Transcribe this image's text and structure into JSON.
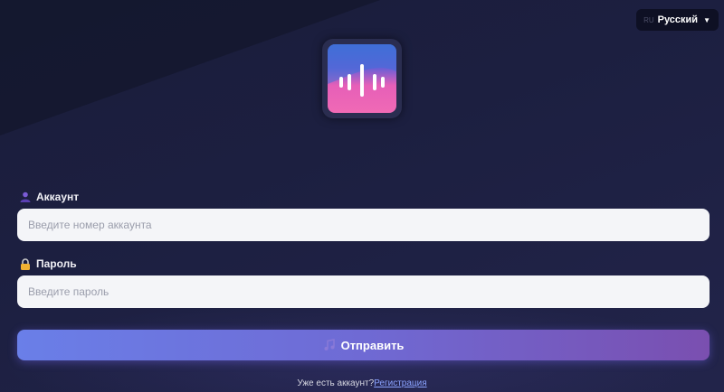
{
  "language": {
    "code": "RU",
    "label": "Русский",
    "caret_icon": "caret-down-icon"
  },
  "logo": {
    "icon": "sound-wave-icon",
    "colors": [
      "#3d6fd6",
      "#6b5fd6",
      "#f06ab5"
    ]
  },
  "form": {
    "account": {
      "label": "Аккаунт",
      "icon": "user-icon",
      "placeholder": "Введите номер аккаунта",
      "value": ""
    },
    "password": {
      "label": "Пароль",
      "icon": "lock-icon",
      "placeholder": "Введите пароль",
      "value": ""
    },
    "submit": {
      "label": "Отправить",
      "icon": "music-note-icon"
    }
  },
  "footer": {
    "prompt": "Уже есть аккаунт?",
    "link": "Регистрация"
  },
  "colors": {
    "background": "#1c1f40",
    "button_start": "#6a7fe8",
    "button_end": "#7a4fb0",
    "link": "#8aa3ff"
  }
}
